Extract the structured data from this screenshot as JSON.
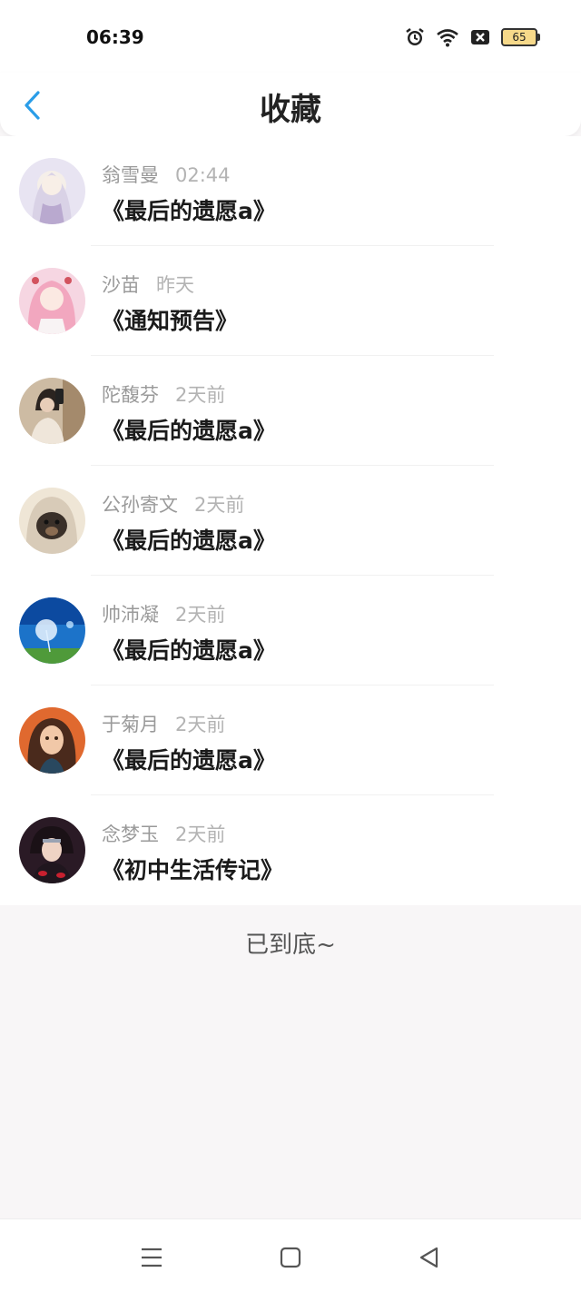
{
  "status_bar": {
    "time": "06:39",
    "battery": "65",
    "icons": [
      "alarm-icon",
      "wifi-icon",
      "sim-blocked-icon",
      "battery-icon"
    ]
  },
  "header": {
    "title": "收藏",
    "back_icon": "chevron-left-icon"
  },
  "favorites": [
    {
      "user": "翁雪曼",
      "time": "02:44",
      "book": "《最后的遗愿a》",
      "avatar": "anime-girl-white-hair"
    },
    {
      "user": "沙苗",
      "time": "昨天",
      "book": "《通知预告》",
      "avatar": "anime-girl-pink-hair"
    },
    {
      "user": "陀馥芬",
      "time": "2天前",
      "book": "《最后的遗愿a》",
      "avatar": "girl-mirror-selfie"
    },
    {
      "user": "公孙寄文",
      "time": "2天前",
      "book": "《最后的遗愿a》",
      "avatar": "dog-in-hood"
    },
    {
      "user": "帅沛凝",
      "time": "2天前",
      "book": "《最后的遗愿a》",
      "avatar": "dandelion-sky"
    },
    {
      "user": "于菊月",
      "time": "2天前",
      "book": "《最后的遗愿a》",
      "avatar": "cartoon-girl-curly-hair"
    },
    {
      "user": "念梦玉",
      "time": "2天前",
      "book": "《初中生活传记》",
      "avatar": "anime-ninja-character"
    }
  ],
  "footer": {
    "end_text": "已到底~"
  },
  "nav_bar": {
    "buttons": [
      "menu-icon",
      "home-square-icon",
      "back-triangle-icon"
    ]
  },
  "colors": {
    "accent": "#2a9de8",
    "background": "#f8f6f7",
    "primary_text": "#1b1b1b",
    "secondary_text": "#9a9a9a"
  }
}
